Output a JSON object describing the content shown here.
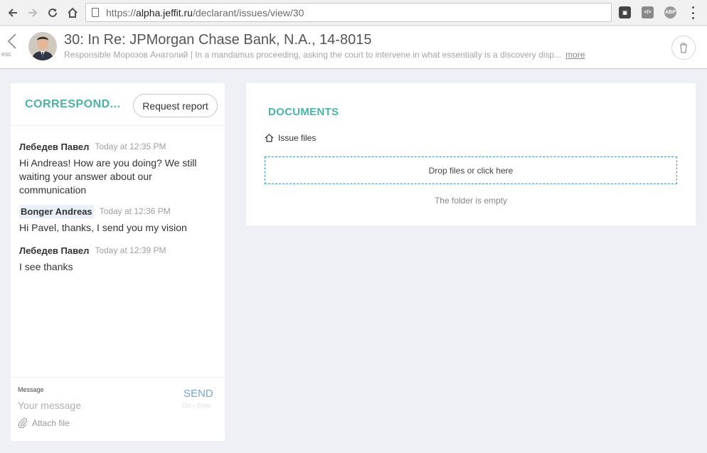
{
  "browser": {
    "url_prefix": "https://",
    "url_host": "alpha.jeffit.ru",
    "url_path": "/declarant/issues/view/30",
    "extensions": [
      {
        "name": "extension-icon",
        "label": ""
      },
      {
        "name": "code-extension-icon",
        "label": "</>"
      },
      {
        "name": "adblock-icon",
        "label": "ABP"
      }
    ]
  },
  "header": {
    "esc_label": "esc",
    "title": "30: In Re: JPMorgan Chase Bank, N.A., 14-8015",
    "subtitle": "Responsible Морозов Анатолий | In a mandamus proceeding, asking the court to intervene in what essentially is a discovery disp...",
    "more_label": "more"
  },
  "correspondence": {
    "title": "CORRESPOND...",
    "request_report_label": "Request report",
    "messages": [
      {
        "author": "Лебедев Павел",
        "time": "Today at 12:35 PM",
        "text": "Hi Andreas! How are you doing? We still waiting your answer about our communication"
      },
      {
        "author": "Bonger Andreas",
        "time": "Today at 12:36 PM",
        "text": "Hi Pavel, thanks, I send you my vision"
      },
      {
        "author": "Лебедев Павел",
        "time": "Today at 12:39 PM",
        "text": "I see thanks"
      }
    ],
    "compose": {
      "label": "Message",
      "placeholder": "Your message",
      "send_label": "SEND",
      "send_hint": "Ctrl + Enter",
      "attach_label": "Attach file"
    }
  },
  "documents": {
    "title": "DOCUMENTS",
    "breadcrumb": "Issue files",
    "dropzone_label": "Drop files or click here",
    "empty_label": "The folder is empty"
  },
  "colors": {
    "accent": "#4ab3a8",
    "send": "#7aa5d0",
    "page_bg": "#eef0f5"
  }
}
